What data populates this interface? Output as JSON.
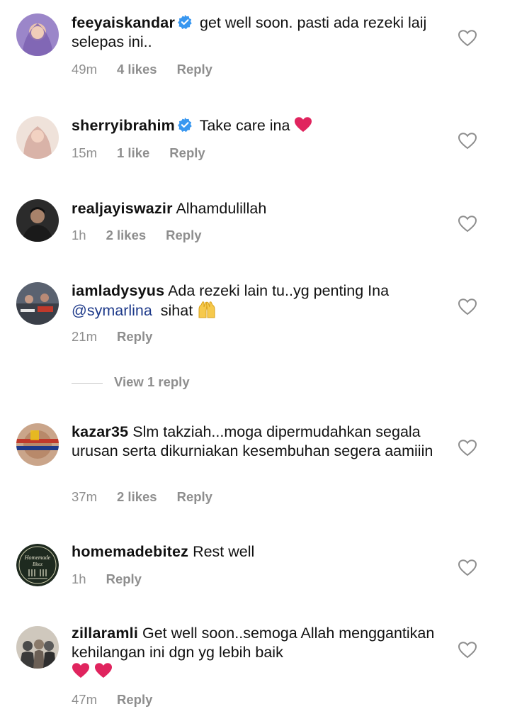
{
  "comments": [
    {
      "username": "feeyaiskandar",
      "verified": true,
      "text": "get well soon. pasti ada rezeki laij selepas ini..",
      "time": "49m",
      "likes": "4 likes",
      "reply_label": "Reply",
      "avatar": "woman-in-purple-hijab"
    },
    {
      "username": "sherryibrahim",
      "verified": true,
      "text": "Take care ina",
      "emoji": "red-heart",
      "time": "15m",
      "likes": "1 like",
      "reply_label": "Reply",
      "avatar": "woman-in-pink-hijab"
    },
    {
      "username": "realjayiswazir",
      "verified": false,
      "text": "Alhamdulillah",
      "time": "1h",
      "likes": "2 likes",
      "reply_label": "Reply",
      "avatar": "man-portrait"
    },
    {
      "username": "iamladysyus",
      "verified": false,
      "text": "Ada rezeki lain tu..yg penting Ina",
      "mention": "@symarlina",
      "text_after": "sihat",
      "emoji": "raised-hands",
      "time": "21m",
      "likes": "",
      "reply_label": "Reply",
      "avatar": "people-in-crowd"
    },
    {
      "username": "kazar35",
      "verified": false,
      "text": "Slm takziah...moga dipermudahkan segala urusan serta dikurniakan kesembuhan segera aamiiin",
      "time": "37m",
      "likes": "2 likes",
      "reply_label": "Reply",
      "avatar": "face-with-flag-paint"
    },
    {
      "username": "homemadebitez",
      "verified": false,
      "text": "Rest well",
      "time": "1h",
      "likes": "",
      "reply_label": "Reply",
      "avatar": "homemade-bitez-logo"
    },
    {
      "username": "zillaramli",
      "verified": false,
      "text": "Get well soon..semoga Allah menggantikan kehilangan ini dgn yg lebih baik",
      "emoji": "red-heart-x2",
      "time": "47m",
      "likes": "",
      "reply_label": "Reply",
      "avatar": "group-photo"
    }
  ],
  "view_replies": "View 1 reply",
  "avatar_logo_text": {
    "line1": "Homemade",
    "line2": "Bitez"
  },
  "colors": {
    "meta_gray": "#8e8e8e",
    "verified_blue": "#3897f0",
    "mention_blue": "#1e3a8a",
    "heart_red": "#e0245e"
  },
  "icons": {
    "like": "heart-outline-icon",
    "verified": "verified-badge-icon"
  }
}
